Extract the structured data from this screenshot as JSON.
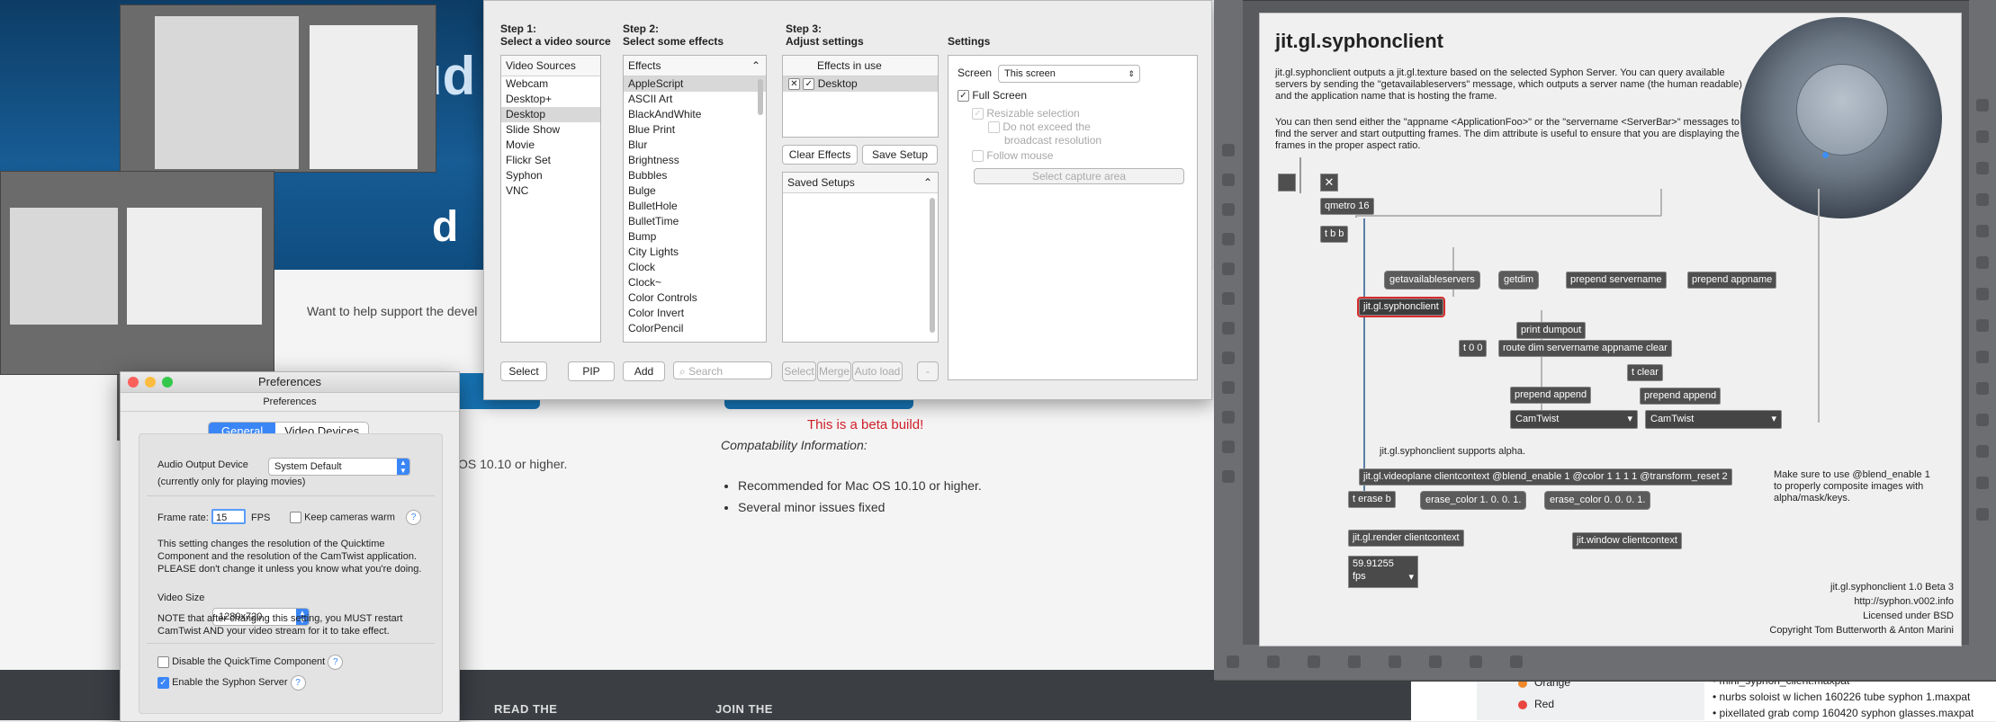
{
  "website": {
    "support_text": "Want to help support the devel",
    "os_text": "OS 10.10 or higher.",
    "beta_text": "This is a beta build!",
    "compat_title": "Compatability Information:",
    "bullets": [
      "Recommended for Mac OS 10.10 or higher.",
      "Several minor issues fixed"
    ],
    "footer_left": "READ THE",
    "footer_right": "JOIN THE",
    "banner_letters": "ud",
    "banner_d": "d"
  },
  "camtwist": {
    "step1": {
      "title": "Step 1:",
      "subtitle": "Select a video source"
    },
    "step2": {
      "title": "Step 2:",
      "subtitle": "Select some effects"
    },
    "step3": {
      "title": "Step 3:",
      "subtitle": "Adjust settings"
    },
    "settings_title": "Settings",
    "video_sources_header": "Video Sources",
    "video_sources": [
      "Webcam",
      "Desktop+",
      "Desktop",
      "Slide Show",
      "Movie",
      "Flickr Set",
      "Syphon",
      "VNC"
    ],
    "selected_source": "Desktop",
    "effects_header": "Effects",
    "effects": [
      "AppleScript",
      "ASCII Art",
      "BlackAndWhite",
      "Blue Print",
      "Blur",
      "Brightness",
      "Bubbles",
      "Bulge",
      "BulletHole",
      "BulletTime",
      "Bump",
      "City Lights",
      "Clock",
      "Clock~",
      "Color Controls",
      "Color Invert",
      "ColorPencil"
    ],
    "effects_in_use_header": "Effects in use",
    "effects_in_use": [
      "Desktop"
    ],
    "clear_effects": "Clear Effects",
    "save_setup": "Save Setup",
    "saved_setups_header": "Saved Setups",
    "buttons": {
      "select": "Select",
      "pip": "PIP",
      "add": "Add",
      "search_placeholder": "Search",
      "select2": "Select",
      "merge": "Merge",
      "auto_load": "Auto load",
      "minus": "-"
    },
    "settings": {
      "screen_label": "Screen",
      "screen_value": "This screen",
      "full_screen": "Full Screen",
      "resizable": "Resizable selection",
      "do_not_exceed": "Do not exceed the",
      "broadcast_res": "broadcast resolution",
      "follow_mouse": "Follow mouse",
      "select_capture": "Select capture area"
    }
  },
  "preferences": {
    "window_title": "Preferences",
    "toolbar_title": "Preferences",
    "tabs": [
      "General",
      "Video Devices"
    ],
    "audio_label": "Audio Output Device",
    "audio_value": "System Default",
    "audio_note": "(currently only for playing movies)",
    "frame_rate_label": "Frame rate:",
    "frame_rate_value": "15",
    "fps_unit": "FPS",
    "keep_cameras_warm": "Keep cameras warm",
    "resolution_note": "This setting changes the resolution of the Quicktime Component and the resolution of the CamTwist application.  PLEASE don't change it unless you know what you're doing.",
    "video_size_label": "Video Size",
    "video_size_value": "1280x720",
    "restart_note": "NOTE that after changing this setting, you MUST restart CamTwist AND your video stream for it to take effect.",
    "disable_qt": "Disable the QuickTime Component",
    "enable_syphon": "Enable the Syphon Server",
    "help": "?"
  },
  "max_patch": {
    "title": "jit.gl.syphonclient",
    "desc1": "jit.gl.syphonclient outputs a jit.gl.texture based on the selected Syphon Server. You can query available servers by sending the \"getavailableservers\" message, which outputs a server name (the human readable) and the application name that is hosting the frame.",
    "desc2": "You can then send either the \"appname <ApplicationFoo>\" or the \"servername <ServerBar>\" messages to find the server and start outputting frames. The dim attribute is useful to ensure that you are displaying the frames in the proper aspect ratio.",
    "objects": {
      "qmetro": "qmetro 16",
      "tbb": "t b b",
      "getavail": "getavailableservers",
      "getdim": "getdim",
      "prepend_servername": "prepend servername",
      "prepend_appname": "prepend appname",
      "syphonclient": "jit.gl.syphonclient",
      "print_dump": "print dumpout",
      "t00": "t 0 0",
      "route": "route dim servername appname clear",
      "tclear": "t clear",
      "prepend_append1": "prepend append",
      "prepend_append2": "prepend append",
      "menu1": "CamTwist",
      "menu2": "CamTwist",
      "supports_alpha": "jit.gl.syphonclient supports alpha.",
      "videoplane": "jit.gl.videoplane clientcontext @blend_enable 1 @color 1 1 1 1 @transform_reset 2",
      "blend_note": "Make sure to use @blend_enable 1 to properly composite images with alpha/mask/keys.",
      "terase": "t erase b",
      "erase1": "erase_color 1. 0. 0. 1.",
      "erase2": "erase_color 0. 0. 0. 1.",
      "render": "jit.gl.render clientcontext",
      "window": "jit.window clientcontext",
      "fps_value": "59.91255",
      "fps_label": "fps"
    },
    "credits": [
      "jit.gl.syphonclient 1.0 Beta 3",
      "http://syphon.v002.info",
      "Licensed under BSD",
      "Copyright Tom Butterworth & Anton Marini"
    ]
  },
  "finder": {
    "tags": [
      {
        "label": "Orange",
        "color": "#f0882a"
      },
      {
        "label": "Red",
        "color": "#e9463f"
      }
    ],
    "files": [
      "mini_syphon_client.maxpat",
      "nurbs soloist w lichen 160226 tube syphon 1.maxpat",
      "pixellated grab comp 160420 syphon glasses.maxpat"
    ]
  },
  "colors": {
    "accent": "#3a86f7",
    "banner": "#175c94",
    "max_bg": "#595a5e",
    "beta_red": "#d0202a"
  }
}
